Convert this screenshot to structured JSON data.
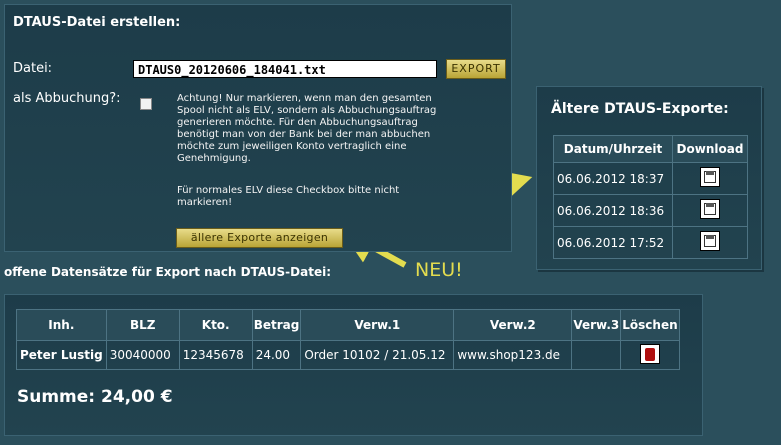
{
  "create": {
    "title": "DTAUS-Datei erstellen:",
    "datei_label": "Datei:",
    "datei_value": "DTAUS0_20120606_184041.txt",
    "export_label": "EXPORT",
    "abbuchung_label": "als Abbuchung?:",
    "note1": "Achtung! Nur markieren, wenn man den gesamten Spool nicht als ELV, sondern als Abbuchungsauftrag generieren möchte. Für den Abbuchungsauftrag benötigt man von der Bank bei der man abbuchen möchte zum jeweiligen Konto vertraglich eine Genehmigung.",
    "note2": "Für normales ELV diese Checkbox bitte nicht markieren!",
    "show_exports_label": "ällere Exporte anzeigen"
  },
  "exports": {
    "title": "Ältere DTAUS-Exporte:",
    "headers": [
      "Datum/Uhrzeit",
      "Download"
    ],
    "rows": [
      {
        "date": "06.06.2012 18:37",
        "icon": "save-icon"
      },
      {
        "date": "06.06.2012 18:36",
        "icon": "save-icon"
      },
      {
        "date": "06.06.2012 17:52",
        "icon": "save-icon"
      }
    ]
  },
  "records": {
    "title": "offene Datensätze für Export nach DTAUS-Datei:",
    "headers": [
      "Inh.",
      "BLZ",
      "Kto.",
      "Betrag",
      "Verw.1",
      "Verw.2",
      "Verw.3",
      "Löschen"
    ],
    "rows": [
      {
        "inh": "Peter Lustig",
        "blz": "30040000",
        "kto": "12345678",
        "betrag": "24.00",
        "verw1": "Order 10102 / 21.05.12",
        "verw2": "www.shop123.de",
        "verw3": "",
        "icon": "delete-icon"
      }
    ],
    "summe": "Summe: 24,00 €"
  },
  "annotation": {
    "neu": "NEU!",
    "color": "#e3dc4f"
  }
}
